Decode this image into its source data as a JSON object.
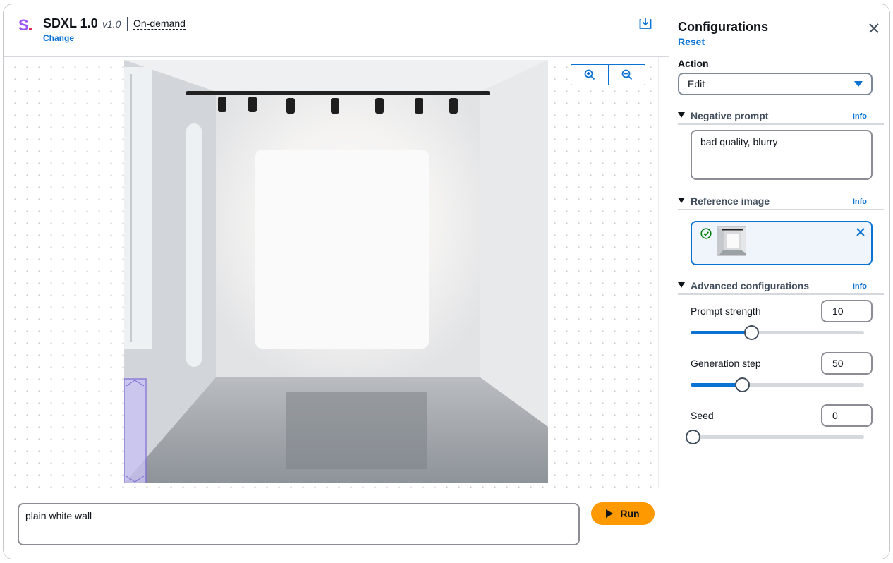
{
  "header": {
    "logo": "S",
    "model_name": "SDXL 1.0",
    "model_version": "v1.0",
    "mode": "On-demand",
    "change_label": "Change"
  },
  "canvas": {
    "zoom_in_icon": "zoom-in-icon",
    "zoom_out_icon": "zoom-out-icon"
  },
  "prompt": {
    "value": "plain white wall",
    "run_label": "Run"
  },
  "config": {
    "title": "Configurations",
    "reset_label": "Reset",
    "action_label": "Action",
    "action_value": "Edit",
    "negative_prompt": {
      "label": "Negative prompt",
      "info": "Info",
      "value": "bad quality, blurry"
    },
    "reference_image": {
      "label": "Reference image",
      "info": "Info"
    },
    "advanced": {
      "label": "Advanced configurations",
      "info": "Info",
      "prompt_strength": {
        "label": "Prompt strength",
        "value": "10",
        "fraction": 0.35
      },
      "generation_step": {
        "label": "Generation step",
        "value": "50",
        "fraction": 0.3
      },
      "seed": {
        "label": "Seed",
        "value": "0",
        "fraction": 0.0
      }
    }
  },
  "colors": {
    "accent": "#0972d3",
    "run_button": "#ff9900",
    "logo": "#9b55f5"
  }
}
